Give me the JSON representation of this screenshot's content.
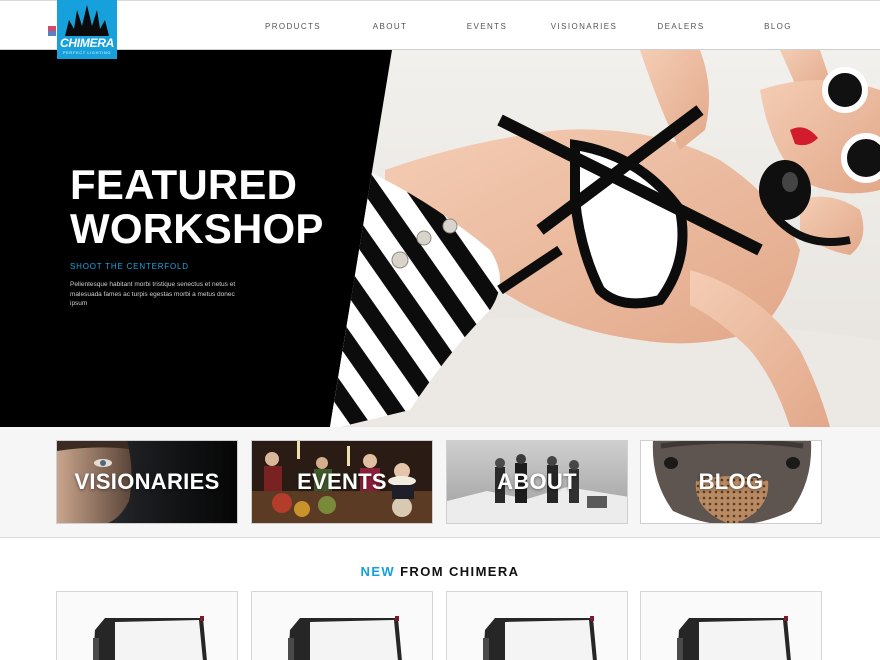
{
  "brand": {
    "name": "CHIMERA",
    "tagline": "PERFECT LIGHTING",
    "accent_color": "#16a0dc"
  },
  "nav": {
    "items": [
      {
        "label": "PRODUCTS"
      },
      {
        "label": "ABOUT"
      },
      {
        "label": "EVENTS"
      },
      {
        "label": "VISIONARIES"
      },
      {
        "label": "DEALERS"
      },
      {
        "label": "BLOG"
      }
    ]
  },
  "hero": {
    "title": "FEATURED\nWORKSHOP",
    "subtitle": "SHOOT THE CENTERFOLD",
    "body": "Pellentesque habitant morbi tristique senectus et netus et malesuada fames ac turpis egestas morbi a metus donec ipsum"
  },
  "categories": [
    {
      "label": "VISIONARIES"
    },
    {
      "label": "EVENTS"
    },
    {
      "label": "ABOUT"
    },
    {
      "label": "BLOG"
    }
  ],
  "new_from": {
    "accent": "NEW",
    "rest": "FROM CHIMERA"
  },
  "products": [
    {
      "icon": "lightbank-softbox-icon"
    },
    {
      "icon": "lightbank-softbox-icon"
    },
    {
      "icon": "lightbank-softbox-icon"
    },
    {
      "icon": "lightbank-softbox-icon"
    }
  ]
}
